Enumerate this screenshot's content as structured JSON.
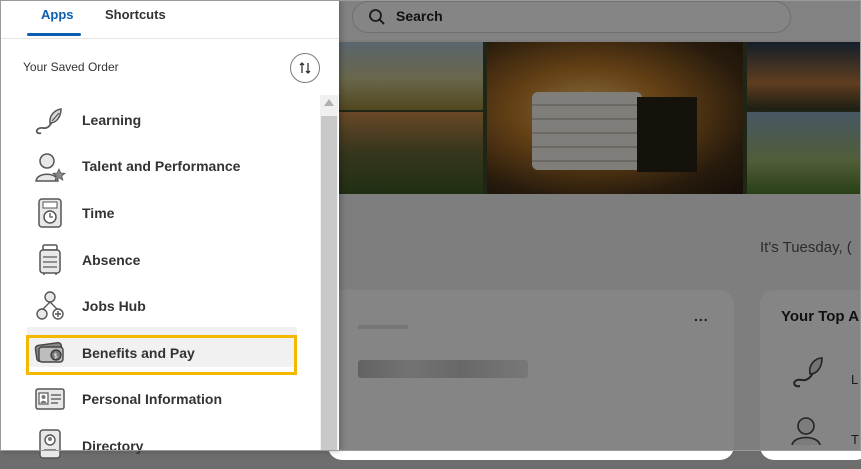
{
  "tabs": {
    "apps": "Apps",
    "shortcuts": "Shortcuts"
  },
  "panel": {
    "saved_order": "Your Saved Order",
    "sort_icon": "sort-arrows-icon"
  },
  "apps": [
    {
      "label": "Learning",
      "icon": "learning-icon"
    },
    {
      "label": "Talent and Performance",
      "icon": "talent-icon"
    },
    {
      "label": "Time",
      "icon": "time-icon"
    },
    {
      "label": "Absence",
      "icon": "absence-icon"
    },
    {
      "label": "Jobs Hub",
      "icon": "jobs-hub-icon"
    },
    {
      "label": "Benefits and Pay",
      "icon": "benefits-pay-icon",
      "highlighted": true
    },
    {
      "label": "Personal Information",
      "icon": "personal-info-icon"
    },
    {
      "label": "Directory",
      "icon": "directory-icon"
    }
  ],
  "background": {
    "search_placeholder": "Search",
    "greeting": "It's Tuesday, (",
    "card_menu": "...",
    "top_apps_title": "Your Top A",
    "top_app_1": "L",
    "top_app_2": "T"
  },
  "colors": {
    "accent": "#0b5eb0",
    "highlight": "#f5b800"
  }
}
